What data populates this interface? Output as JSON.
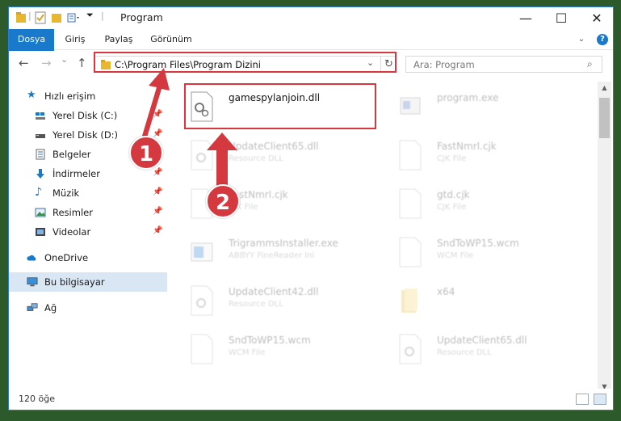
{
  "window": {
    "title": "Program",
    "controls": {
      "minimize": "—",
      "maximize": "☐",
      "close": "✕"
    }
  },
  "ribbon": {
    "tabs": [
      "Dosya",
      "Giriş",
      "Paylaş",
      "Görünüm"
    ],
    "help": "?"
  },
  "navbar": {
    "back": "←",
    "forward": "→",
    "up": "↑",
    "recent": "⌄",
    "address": "C:\\Program Files\\Program Dizini",
    "address_dropdown": "⌄",
    "refresh": "↻",
    "search_placeholder": "Ara: Program"
  },
  "sidebar": {
    "items": [
      {
        "label": "Hızlı erişim",
        "icon": "star-icon"
      },
      {
        "label": "Yerel Disk (C:)",
        "icon": "drive-icon"
      },
      {
        "label": "Yerel Disk (D:)",
        "icon": "drive-icon"
      },
      {
        "label": "Belgeler",
        "icon": "documents-icon"
      },
      {
        "label": "İndirmeler",
        "icon": "download-icon"
      },
      {
        "label": "Müzik",
        "icon": "music-icon"
      },
      {
        "label": "Resimler",
        "icon": "pictures-icon"
      },
      {
        "label": "Videolar",
        "icon": "video-icon"
      },
      {
        "label": "OneDrive",
        "icon": "cloud-icon"
      },
      {
        "label": "Bu bilgisayar",
        "icon": "computer-icon"
      },
      {
        "label": "Ağ",
        "icon": "network-icon"
      }
    ],
    "pin": "📌"
  },
  "files": [
    {
      "name": "gamespylanjoin.dll",
      "type": ""
    },
    {
      "name": "program.exe",
      "type": ""
    },
    {
      "name": "UpdateClient65.dll",
      "type": "Resource DLL"
    },
    {
      "name": "FastNmrl.cjk",
      "type": "CJK File"
    },
    {
      "name": "FastNmrl.cjk",
      "type": "CJK File"
    },
    {
      "name": "gtd.cjk",
      "type": "CJK File"
    },
    {
      "name": "TrigrammsInstaller.exe",
      "type": "ABBYY FineReader Ini"
    },
    {
      "name": "SndToWP15.wcm",
      "type": "WCM File"
    },
    {
      "name": "UpdateClient42.dll",
      "type": "Resource DLL"
    },
    {
      "name": "x64",
      "type": ""
    },
    {
      "name": "SndToWP15.wcm",
      "type": "WCM File"
    },
    {
      "name": "UpdateClient65.dll",
      "type": "Resource DLL"
    }
  ],
  "status": {
    "count": "120 öğe"
  },
  "annotations": {
    "step1": "1",
    "step2": "2"
  },
  "colors": {
    "accent": "#1979ca",
    "highlight": "#d9363e",
    "selected": "#d9e7f5"
  }
}
